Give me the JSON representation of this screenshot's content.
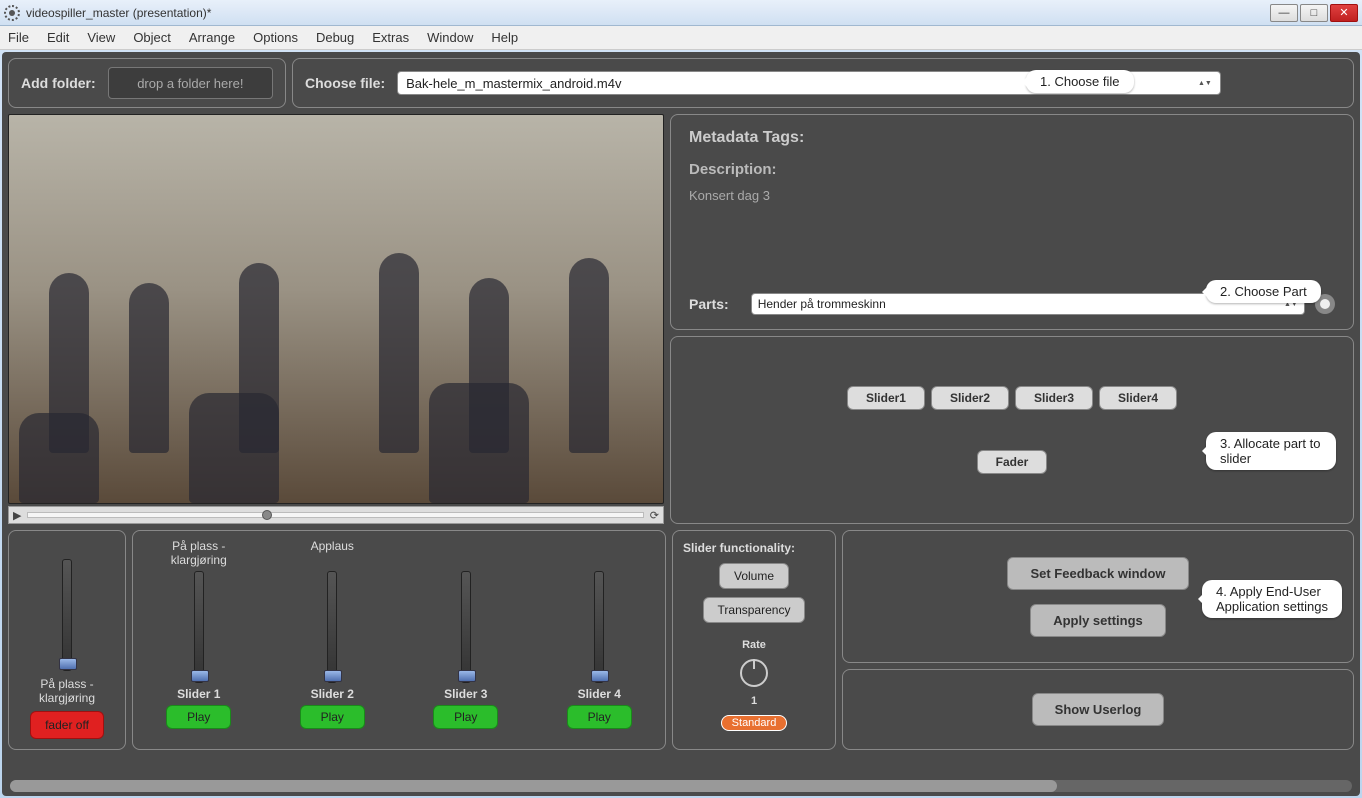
{
  "window": {
    "title": "videospiller_master (presentation)*"
  },
  "menu": {
    "file": "File",
    "edit": "Edit",
    "view": "View",
    "object": "Object",
    "arrange": "Arrange",
    "options": "Options",
    "debug": "Debug",
    "extras": "Extras",
    "window": "Window",
    "help": "Help"
  },
  "add_folder": {
    "label": "Add folder:",
    "placeholder": "drop a folder here!"
  },
  "choose_file": {
    "label": "Choose file:",
    "value": "Bak-hele_m_mastermix_android.m4v"
  },
  "callouts": {
    "c1": "1. Choose file",
    "c2": "2. Choose Part",
    "c3": "3. Allocate part to slider",
    "c4": "4. Apply End-User Application settings"
  },
  "metadata": {
    "title": "Metadata Tags:",
    "desc_label": "Description:",
    "desc": "Konsert dag 3",
    "parts_label": "Parts:",
    "parts_value": "Hender på trommeskinn"
  },
  "alloc": {
    "slider1": "Slider1",
    "slider2": "Slider2",
    "slider3": "Slider3",
    "slider4": "Slider4",
    "fader": "Fader"
  },
  "fader": {
    "caption": "På plass - klargjøring",
    "button": "fader off"
  },
  "sliders": {
    "s1": {
      "top": "På plass - klargjøring",
      "name": "Slider 1",
      "play": "Play"
    },
    "s2": {
      "top": "Applaus",
      "name": "Slider 2",
      "play": "Play"
    },
    "s3": {
      "top": "",
      "name": "Slider 3",
      "play": "Play"
    },
    "s4": {
      "top": "",
      "name": "Slider 4",
      "play": "Play"
    }
  },
  "func": {
    "title": "Slider functionality:",
    "volume": "Volume",
    "transparency": "Transparency",
    "rate_label": "Rate",
    "rate_value": "1",
    "standard": "Standard"
  },
  "settings": {
    "feedback": "Set Feedback window",
    "apply": "Apply settings",
    "userlog": "Show Userlog"
  }
}
